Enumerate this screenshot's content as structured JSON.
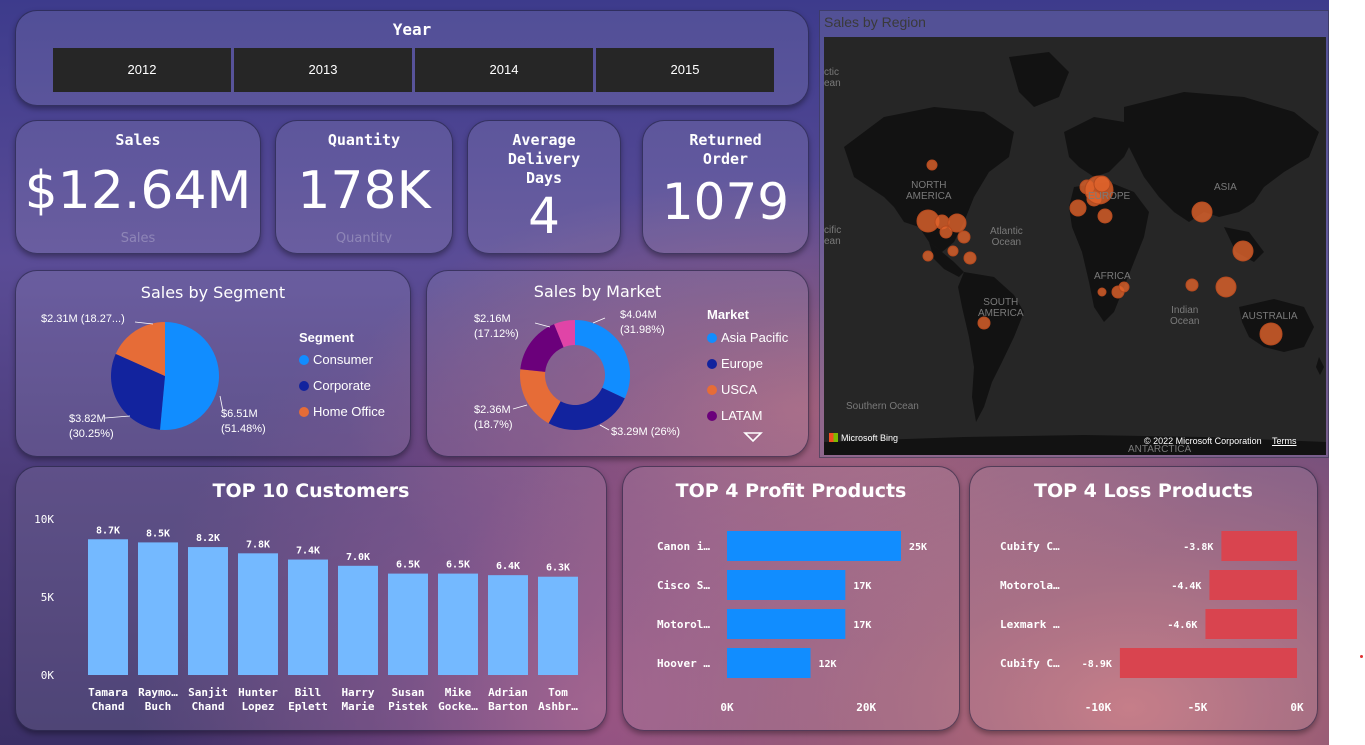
{
  "year_slicer": {
    "title": "Year",
    "options": [
      "2012",
      "2013",
      "2014",
      "2015"
    ]
  },
  "kpis": {
    "sales": {
      "title": "Sales",
      "value": "$12.64M",
      "faded_label": "Sales"
    },
    "quantity": {
      "title": "Quantity",
      "value": "178K",
      "faded_label": "Quantity"
    },
    "delivery": {
      "title_line1": "Average",
      "title_line2": "Delivery",
      "title_line3": "Days",
      "value": "4"
    },
    "returned": {
      "title_line1": "Returned",
      "title_line2": "Order",
      "value": "1079"
    }
  },
  "segment": {
    "title": "Sales by Segment",
    "legend_title": "Segment",
    "legend": [
      "Consumer",
      "Corporate",
      "Home Office"
    ],
    "labels": {
      "consumer": "$6.51M\n(51.48%)",
      "corporate": "$3.82M\n(30.25%)",
      "home_office": "$2.31M (18.27...)"
    },
    "colors": [
      "#118DFF",
      "#12239E",
      "#E66C37"
    ]
  },
  "market": {
    "title": "Sales by Market",
    "legend_title": "Market",
    "legend": [
      "Asia Pacific",
      "Europe",
      "USCA",
      "LATAM"
    ],
    "labels": {
      "asia_pacific": "$4.04M\n(31.98%)",
      "europe": "$3.29M (26%)",
      "usca": "$2.36M\n(18.7%)",
      "latam": "$2.16M\n(17.12%)"
    },
    "colors": [
      "#118DFF",
      "#12239E",
      "#E66C37",
      "#6B007B",
      "#E044A7"
    ]
  },
  "map": {
    "title": "Sales by Region",
    "labels": [
      "NORTH\nAMERICA",
      "EUROPE",
      "ASIA",
      "AFRICA",
      "SOUTH\nAMERICA",
      "AUSTRALIA",
      "Atlantic\nOcean",
      "Indian\nOcean",
      "Southern Ocean",
      "ANTARCTICA",
      "ctic\nean",
      "cific\nean"
    ],
    "brand": "Microsoft Bing",
    "copyright": "© 2022 Microsoft Corporation",
    "terms": "Terms",
    "bubble_color": "#E2642C"
  },
  "chart_data": [
    {
      "type": "bar",
      "title": "TOP 10 Customers",
      "categories": [
        "Tamara Chand",
        "Raymo… Buch",
        "Sanjit Chand",
        "Hunter Lopez",
        "Bill Eplett",
        "Harry Marie",
        "Susan Pistek",
        "Mike Gocke…",
        "Adrian Barton",
        "Tom Ashbr…"
      ],
      "values": [
        8700,
        8500,
        8200,
        7800,
        7400,
        7000,
        6500,
        6500,
        6400,
        6300
      ],
      "data_labels": [
        "8.7K",
        "8.5K",
        "8.2K",
        "7.8K",
        "7.4K",
        "7.0K",
        "6.5K",
        "6.5K",
        "6.4K",
        "6.3K"
      ],
      "yticks": [
        "0K",
        "5K",
        "10K"
      ],
      "ylim": [
        0,
        10000
      ],
      "color": "#74B9FF"
    },
    {
      "type": "bar",
      "orientation": "horizontal",
      "title": "TOP 4 Profit Products",
      "categories": [
        "Canon i…",
        "Cisco S…",
        "Motorol…",
        "Hoover …"
      ],
      "values": [
        25000,
        17000,
        17000,
        12000
      ],
      "data_labels": [
        "25K",
        "17K",
        "17K",
        "12K"
      ],
      "xticks": [
        "0K",
        "20K"
      ],
      "xlim": [
        0,
        25000
      ],
      "color": "#118DFF"
    },
    {
      "type": "bar",
      "orientation": "horizontal",
      "title": "TOP 4 Loss Products",
      "categories": [
        "Cubify C…",
        "Motorola…",
        "Lexmark …",
        "Cubify C…"
      ],
      "values": [
        -3800,
        -4400,
        -4600,
        -8900
      ],
      "data_labels": [
        "-3.8K",
        "-4.4K",
        "-4.6K",
        "-8.9K"
      ],
      "xticks": [
        "-10K",
        "-5K",
        "0K"
      ],
      "xlim": [
        -10000,
        0
      ],
      "color": "#D9444F"
    }
  ]
}
